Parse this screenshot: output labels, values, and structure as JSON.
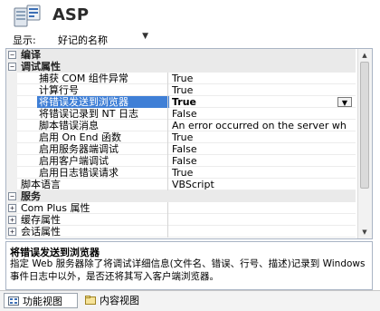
{
  "header": {
    "title": "ASP"
  },
  "showbar": {
    "label": "显示:",
    "selected": "好记的名称"
  },
  "grid": {
    "rows": [
      {
        "type": "cat",
        "expander": "⊟",
        "name": "编译",
        "value": ""
      },
      {
        "type": "cat",
        "expander": "⊟",
        "name": "调试属性",
        "value": ""
      },
      {
        "type": "prop",
        "name": "捕获 COM 组件异常",
        "value": "True"
      },
      {
        "type": "prop",
        "name": "计算行号",
        "value": "True"
      },
      {
        "type": "prop",
        "name": "将错误发送到浏览器",
        "value": "True",
        "selected": true
      },
      {
        "type": "prop",
        "name": "将错误记录到 NT 日志",
        "value": "False"
      },
      {
        "type": "prop",
        "name": "脚本错误消息",
        "value": "An error occurred on the server wh"
      },
      {
        "type": "prop",
        "name": "启用 On End 函数",
        "value": "True"
      },
      {
        "type": "prop",
        "name": "启用服务器端调试",
        "value": "False"
      },
      {
        "type": "prop",
        "name": "启用客户端调试",
        "value": "False"
      },
      {
        "type": "prop",
        "name": "启用日志错误请求",
        "value": "True"
      },
      {
        "type": "plain",
        "name": "脚本语言",
        "value": "VBScript"
      },
      {
        "type": "cat",
        "expander": "⊟",
        "name": "服务",
        "value": ""
      },
      {
        "type": "sub",
        "expander": "⊞",
        "name": "Com Plus 属性",
        "value": ""
      },
      {
        "type": "sub",
        "expander": "⊞",
        "name": "缓存属性",
        "value": ""
      },
      {
        "type": "sub",
        "expander": "⊞",
        "name": "会话属性",
        "value": ""
      }
    ]
  },
  "description": {
    "title": "将错误发送到浏览器",
    "text": "指定 Web 服务器除了将调试详细信息(文件名、错误、行号、描述)记录到 Windows 事件日志中以外，是否还将其写入客户端浏览器。"
  },
  "tabs": [
    {
      "label": "功能视图",
      "active": true,
      "icon": "feature-view-icon"
    },
    {
      "label": "内容视图",
      "active": false,
      "icon": "content-view-icon"
    }
  ]
}
